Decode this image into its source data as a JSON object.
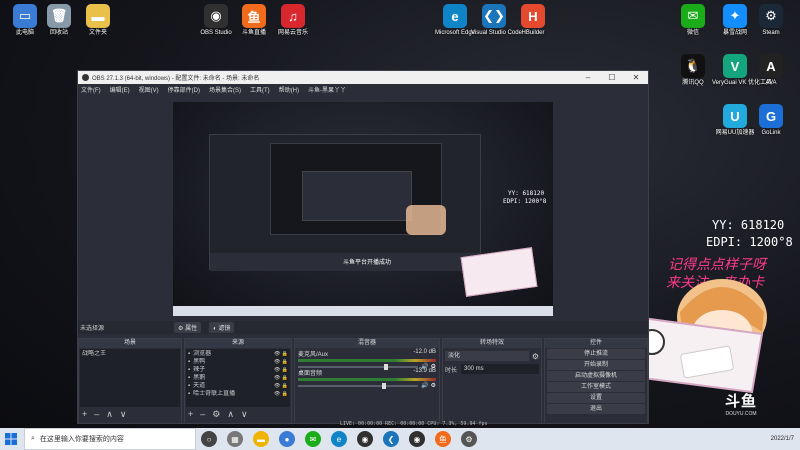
{
  "desktop": {
    "icons_left": [
      {
        "label": "此电脑",
        "color": "#3a7bd5",
        "glyph": "▭"
      },
      {
        "label": "回收站",
        "color": "#8899aa",
        "glyph": "🗑"
      },
      {
        "label": "文件夹",
        "color": "#e8c04a",
        "glyph": "▬"
      },
      {
        "label": "OBS Studio",
        "color": "#303030",
        "glyph": "◉"
      },
      {
        "label": "斗鱼直播",
        "color": "#f26b1d",
        "glyph": "鱼"
      },
      {
        "label": "网易云音乐",
        "color": "#d9272e",
        "glyph": "♫"
      },
      {
        "label": "Microsoft Edge",
        "color": "#0f84c7",
        "glyph": "e"
      },
      {
        "label": "Visual Studio Code",
        "color": "#1b75bb",
        "glyph": "❮❯"
      },
      {
        "label": "HBuilder",
        "color": "#e64a2e",
        "glyph": "H"
      }
    ],
    "icons_right": [
      {
        "label": "微信",
        "color": "#1aad19",
        "glyph": "✉"
      },
      {
        "label": "暴雪战网",
        "color": "#148eff",
        "glyph": "✦"
      },
      {
        "label": "Steam",
        "color": "#1b2838",
        "glyph": "⚙"
      },
      {
        "label": "腾讯QQ",
        "color": "#111111",
        "glyph": "🐧"
      },
      {
        "label": "VeryGuai VK 优化工具",
        "color": "#15a57e",
        "glyph": "V"
      },
      {
        "label": "AVA",
        "color": "#222222",
        "glyph": "A"
      },
      {
        "label": "网易UU加速器",
        "color": "#22aadd",
        "glyph": "U"
      },
      {
        "label": "GoLink",
        "color": "#1d6fd8",
        "glyph": "G"
      }
    ]
  },
  "overlay": {
    "yy": "YY: 618120",
    "edpi": "EDPI: 1200°8",
    "slogan1": "记得点点样子呀",
    "slogan2": "来关注，来办卡",
    "logo_text": "DOUYU.COM"
  },
  "obs": {
    "title": "OBS 27.1.3 (64-bit, windows) - 配置文件: 未命名 - 场景: 未命名",
    "menu": [
      "文件(F)",
      "编辑(E)",
      "视图(V)",
      "停靠部件(D)",
      "场景集合(S)",
      "工具(T)",
      "帮助(H)",
      "斗鱼-黑果丫丫"
    ],
    "preview_caption": "斗鱼平台开播成功",
    "source_label": "未选择源",
    "properties_btn": "属性",
    "filters_btn": "滤镜",
    "scenes": {
      "title": "场景",
      "items": [
        "战略之王"
      ]
    },
    "sources": {
      "title": "来源",
      "items": [
        "浏览器",
        "黑鸭",
        "辣子",
        "黑鹅",
        "天道",
        "哈士奇联上直播"
      ]
    },
    "mixer": {
      "title": "混音器",
      "channels": [
        {
          "name": "麦克风/Aux",
          "db": "-12.0 dB",
          "level": 0.72
        },
        {
          "name": "桌面音频",
          "db": "-13.9 dB",
          "level": 0.7
        }
      ]
    },
    "transitions": {
      "title": "转场特效",
      "type": "淡化",
      "duration_label": "时长",
      "duration_value": "300 ms"
    },
    "controls": {
      "title": "控件",
      "buttons": [
        "停止推流",
        "开始录制",
        "启动虚拟摄像机",
        "工作室模式",
        "设置",
        "退出"
      ]
    },
    "status": "LIVE: 00:00:00   REC: 00:00:00   CPU: 7.3%, 59.94 fps"
  },
  "taskbar": {
    "search_placeholder": "在这里输入你要搜索的内容",
    "date": "2022/1/7"
  }
}
